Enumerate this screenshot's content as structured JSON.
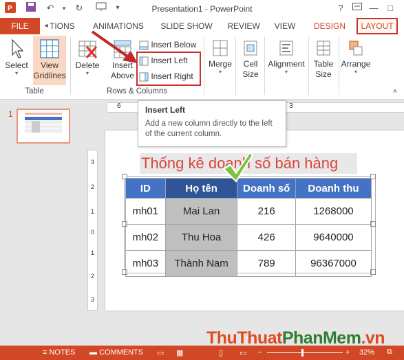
{
  "window": {
    "title": "Presentation1 - PowerPoint",
    "help": "?",
    "minimize": "—",
    "restore": "□",
    "close": "✕"
  },
  "tabs": [
    {
      "label": "FILE"
    },
    {
      "label": "TIONS"
    },
    {
      "label": "ANIMATIONS"
    },
    {
      "label": "SLIDE SHOW"
    },
    {
      "label": "REVIEW"
    },
    {
      "label": "VIEW"
    },
    {
      "label": "DESIGN"
    },
    {
      "label": "LAYOUT"
    }
  ],
  "ribbon": {
    "select": "Select",
    "view_gridlines": [
      "View",
      "Gridlines"
    ],
    "table_group": "Table",
    "delete": "Delete",
    "insert_above": [
      "Insert",
      "Above"
    ],
    "insert_below": "Insert Below",
    "insert_left": "Insert Left",
    "insert_right": "Insert Right",
    "rows_columns_group": "Rows & Columns",
    "merge": "Merge",
    "cell_size": [
      "Cell",
      "Size"
    ],
    "alignment": "Alignment",
    "table_size": [
      "Table",
      "Size"
    ],
    "arrange": "Arrange"
  },
  "tooltip": {
    "title": "Insert Left",
    "body": "Add a new column directly to the left of the current column."
  },
  "ruler_h": [
    "6",
    "3"
  ],
  "ruler_v": [
    "3",
    "2",
    "1",
    "0",
    "1",
    "2",
    "3"
  ],
  "slide_number": "1",
  "slide": {
    "title": "Thống kê doanh số bán hàng",
    "headers": [
      "ID",
      "Họ tên",
      "Doanh số",
      "Doanh thu"
    ],
    "rows": [
      [
        "mh01",
        "Mai Lan",
        "216",
        "1268000"
      ],
      [
        "mh02",
        "Thu Hoa",
        "426",
        "9640000"
      ],
      [
        "mh03",
        "Thành Nam",
        "789",
        "96367000"
      ]
    ]
  },
  "status": {
    "notes": "NOTES",
    "comments": "COMMENTS",
    "zoom": "32%"
  },
  "watermark": {
    "part1": "ThuThuat",
    "part2": "PhanMem",
    "part3": ".vn"
  },
  "colors": {
    "accent": "#d24726",
    "table_header": "#4472c4",
    "selected_column": "#bfbfbf",
    "title_text": "#d9463a"
  }
}
